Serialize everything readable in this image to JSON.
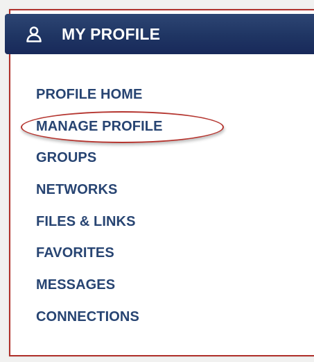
{
  "header": {
    "title": "MY PROFILE",
    "icon": "user-icon"
  },
  "menu": {
    "items": [
      {
        "label": "PROFILE HOME"
      },
      {
        "label": "MANAGE PROFILE",
        "highlighted": true
      },
      {
        "label": "GROUPS"
      },
      {
        "label": "NETWORKS"
      },
      {
        "label": "FILES & LINKS"
      },
      {
        "label": "FAVORITES"
      },
      {
        "label": "MESSAGES"
      },
      {
        "label": "CONNECTIONS"
      }
    ]
  },
  "colors": {
    "header_bg": "#1f3563",
    "menu_text": "#274472",
    "panel_border": "#b0302a",
    "highlight_ring": "#b5352f"
  }
}
